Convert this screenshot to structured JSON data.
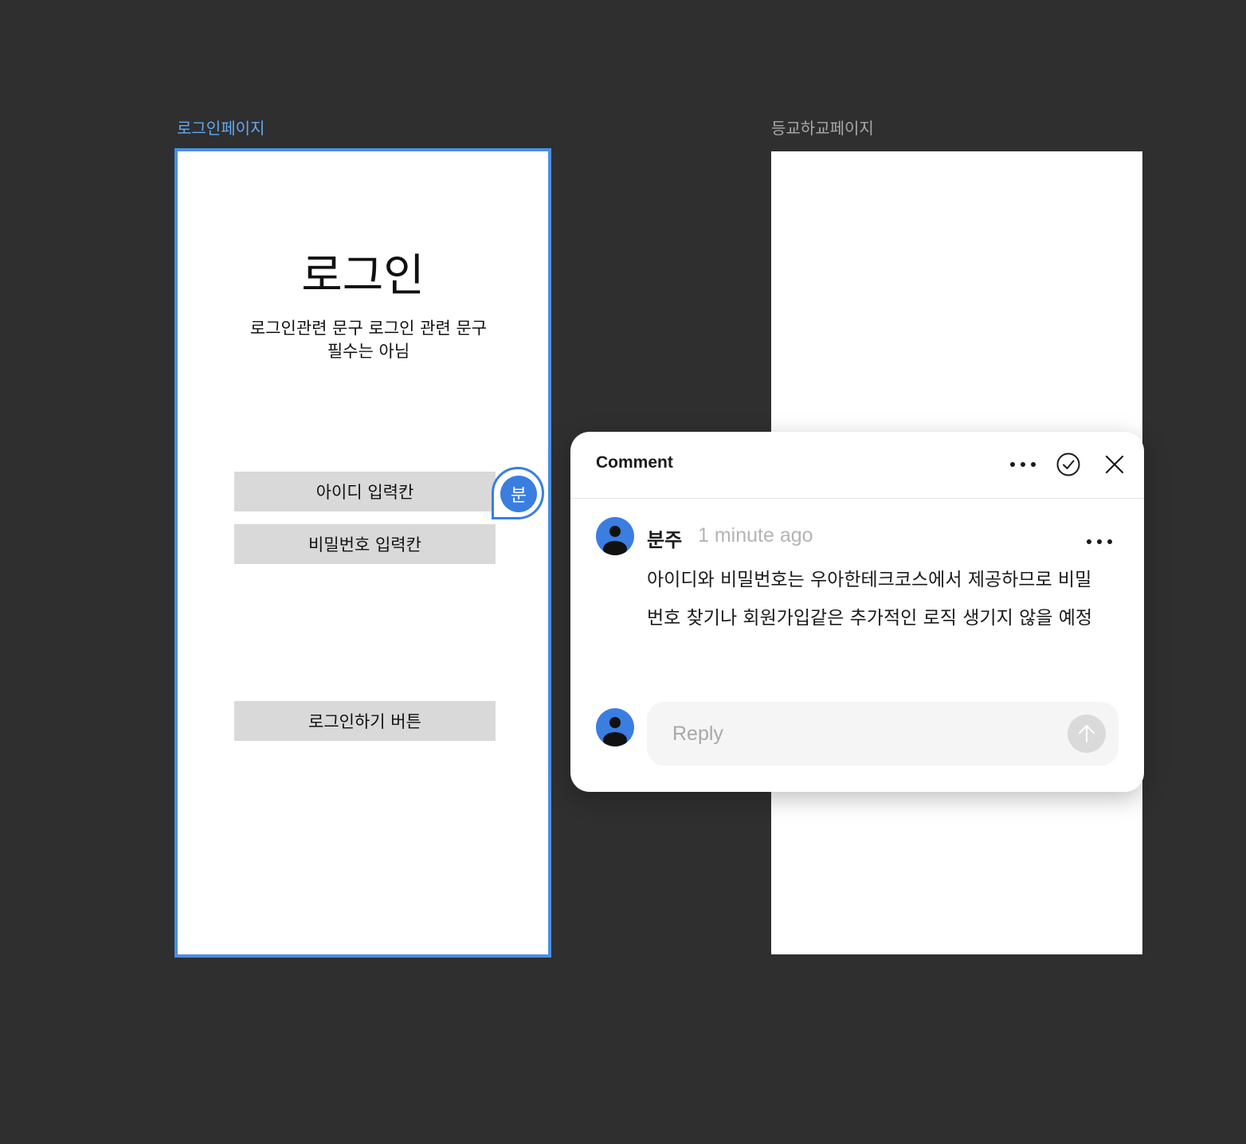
{
  "frames": {
    "login": {
      "label": "로그인페이지",
      "title": "로그인",
      "subtitle": "로그인관련 문구 로그인 관련 문구 필수는 아님",
      "id_input": "아이디 입력칸",
      "pw_input": "비밀번호 입력칸",
      "login_button": "로그인하기 버튼"
    },
    "commute": {
      "label": "등교하교페이지"
    }
  },
  "comment_pin": {
    "initial": "분",
    "color": "#3a7ee0"
  },
  "comment_panel": {
    "title": "Comment",
    "icons": [
      "more-icon",
      "check-circle-icon",
      "close-icon"
    ],
    "comment": {
      "author": "분주",
      "time": "1 minute ago",
      "body": "아이디와 비밀번호는 우아한테크코스에서 제공하므로 비밀번호 찾기나 회원가입같은 추가적인 로직 생기지 않을 예정"
    },
    "reply": {
      "placeholder": "Reply"
    }
  },
  "colors": {
    "canvas": "#2f2f2f",
    "selection": "#4a8fe2",
    "avatar": "#3a7ee0",
    "wireframe_box": "#d9d9d9"
  }
}
